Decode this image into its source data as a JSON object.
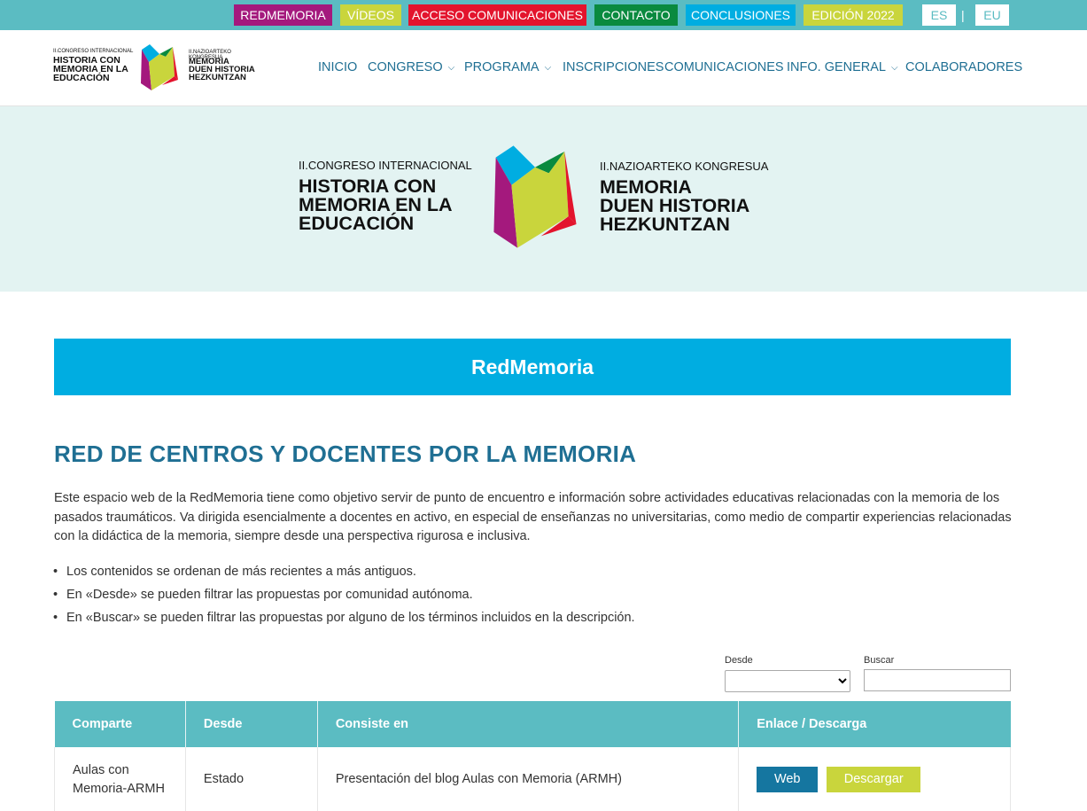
{
  "topbar": {
    "tags": [
      {
        "label": "REDMEMORIA",
        "color": "#a4197d"
      },
      {
        "label": "VÍDEOS",
        "color": "#c9d53c"
      },
      {
        "label": "ACCESO COMUNICACIONES",
        "color": "#e3142d"
      },
      {
        "label": "CONTACTO",
        "color": "#0a8a3f"
      },
      {
        "label": "CONCLUSIONES",
        "color": "#00ade1"
      },
      {
        "label": "EDICIÓN 2022",
        "color": "#c9d53c"
      }
    ],
    "languages": [
      "ES",
      "EU"
    ],
    "separator": "|"
  },
  "logo": {
    "left_line1": "II.CONGRESO INTERNACIONAL",
    "left_line2": "HISTORIA CON",
    "left_line3": "MEMORIA EN LA",
    "left_line4": "EDUCACIÓN",
    "right_line1": "II.NAZIOARTEKO KONGRESUA",
    "right_line2": "MEMORIA",
    "right_line3": "DUEN HISTORIA",
    "right_line4": "HEZKUNTZAN"
  },
  "nav": {
    "items": [
      {
        "label": "INICIO",
        "has_dropdown": false
      },
      {
        "label": "CONGRESO",
        "has_dropdown": true
      },
      {
        "label": "PROGRAMA",
        "has_dropdown": true
      },
      {
        "label": "INSCRIPCIONES",
        "has_dropdown": false
      },
      {
        "label": "COMUNICACIONES",
        "has_dropdown": false
      },
      {
        "label": "INFO. GENERAL",
        "has_dropdown": true
      },
      {
        "label": "COLABORADORES",
        "has_dropdown": false
      }
    ]
  },
  "banner": {
    "title": "RedMemoria"
  },
  "main": {
    "heading": "RED DE CENTROS Y DOCENTES POR LA MEMORIA",
    "intro": "Este espacio web de la RedMemoria tiene como objetivo servir de punto de encuentro e información sobre actividades educativas relacionadas con la memoria de los pasados traumáticos. Va dirigida esencialmente a docentes en activo, en especial de enseñanzas no universitarias, como medio de compartir experiencias relacionadas con la didáctica de la memoria, siempre desde una perspectiva rigurosa e inclusiva.",
    "bullets": [
      "Los contenidos se ordenan de más recientes a más antiguos.",
      "En «Desde» se pueden filtrar las propuestas por comunidad autónoma.",
      "En «Buscar» se pueden filtrar las propuestas por alguno de los términos incluidos en la descripción."
    ]
  },
  "filters": {
    "desde_label": "Desde",
    "desde_value": "",
    "buscar_label": "Buscar",
    "buscar_value": ""
  },
  "table": {
    "headers": [
      "Comparte",
      "Desde",
      "Consiste en",
      "Enlace / Descarga"
    ],
    "rows": [
      {
        "comparte_line1": "Aulas con",
        "comparte_line2": "Memoria-ARMH",
        "desde": "Estado",
        "consiste": "Presentación del blog Aulas con Memoria (ARMH)",
        "web_label": "Web",
        "download_label": "Descargar"
      }
    ]
  },
  "colors": {
    "teal": "#5bbcc2",
    "blue": "#00ade1",
    "dark_blue": "#1f6f93",
    "hero_bg": "#e3f3f2",
    "magenta": "#a4197d",
    "lime": "#c9d53c",
    "red": "#e3142d",
    "green": "#0a8a3f"
  },
  "icons": {
    "dropdown": "chevron-down-icon",
    "logo": "book-logo-icon"
  }
}
